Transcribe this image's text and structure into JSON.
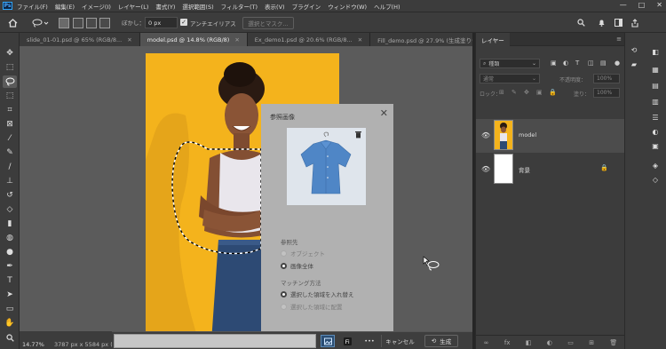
{
  "app": {
    "logo": "Ps"
  },
  "menu": [
    "ファイル(F)",
    "編集(E)",
    "イメージ(I)",
    "レイヤー(L)",
    "書式(Y)",
    "選択範囲(S)",
    "フィルター(T)",
    "表示(V)",
    "プラグイン",
    "ウィンドウ(W)",
    "ヘルプ(H)"
  ],
  "window_controls": [
    "—",
    "□",
    "✕"
  ],
  "options": {
    "feather_label": "ぼかし：",
    "feather_value": "0 px",
    "antialias_label": "アンチエイリアス",
    "antialias_checked": true,
    "select_mask_label": "選択とマスク..."
  },
  "tabs": [
    {
      "label": "slide_01-01.psd @ 65% (RGB/8...",
      "active": false
    },
    {
      "label": "model.psd @ 14.8% (RGB/8)",
      "active": true
    },
    {
      "label": "Ex_demo1.psd @ 20.6% (RGB/8...",
      "active": false
    },
    {
      "label": "Fill_demo.psd @ 27.9% (生成塗りつ...",
      "active": false
    }
  ],
  "status": {
    "zoom": "14.77%",
    "doc_size": "3787 px x 5584 px (30"
  },
  "dialog": {
    "title": "参照画像",
    "close": "✕",
    "reference_section": "参照先",
    "reference_options": [
      {
        "label": "オブジェクト",
        "selected": false,
        "disabled": true
      },
      {
        "label": "画像全体",
        "selected": true,
        "disabled": false
      }
    ],
    "matching_section": "マッチング方法",
    "matching_options": [
      {
        "label": "選択した領域を入れ替え",
        "selected": true,
        "disabled": false
      },
      {
        "label": "選択した領域に配置",
        "selected": false,
        "disabled": true
      }
    ]
  },
  "context_bar": {
    "prompt_value": "",
    "more": "•••",
    "cancel": "キャンセル",
    "generate": "生成"
  },
  "layers_panel": {
    "tab": "レイヤー",
    "filter_kind": "種類",
    "blend_mode": "通常",
    "opacity_label": "不透明度：",
    "opacity_value": "100%",
    "lock_label": "ロック：",
    "fill_label": "塗り：",
    "fill_value": "100%",
    "layers": [
      {
        "name": "model",
        "selected": true
      },
      {
        "name": "背景",
        "selected": false,
        "locked": true
      }
    ],
    "footer_icons": [
      "∞",
      "fx",
      "◧",
      "◐",
      "▭",
      "⊞",
      "🗑"
    ]
  },
  "colors": {
    "accent": "#31a8ff",
    "photo_background": "#f4b31c",
    "shirt": "#4f86c6"
  }
}
